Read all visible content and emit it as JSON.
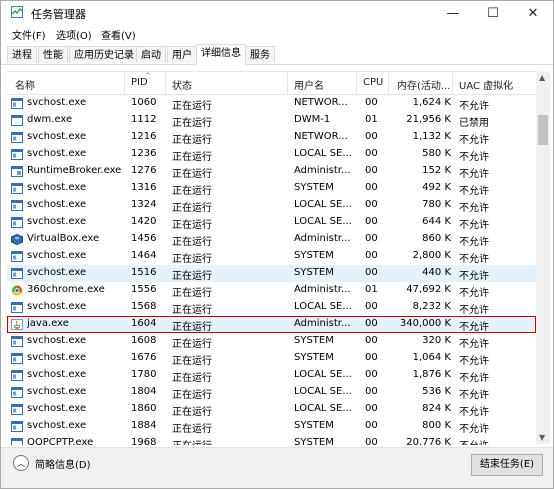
{
  "window": {
    "title": "任务管理器"
  },
  "menu": [
    "文件(F)",
    "选项(O)",
    "查看(V)"
  ],
  "tabs": [
    "进程",
    "性能",
    "应用历史记录",
    "启动",
    "用户",
    "详细信息",
    "服务"
  ],
  "active_tab": "详细信息",
  "columns": [
    "名称",
    "PID",
    "状态",
    "用户名",
    "CPU",
    "内存(活动...",
    "UAC 虚拟化"
  ],
  "rows": [
    {
      "icon": "svchost-icon",
      "name": "svchost.exe",
      "pid": "1060",
      "status": "正在运行",
      "user": "NETWOR...",
      "cpu": "00",
      "mem": "1,624 K",
      "uac": "不允许"
    },
    {
      "icon": "dwm-icon",
      "name": "dwm.exe",
      "pid": "1112",
      "status": "正在运行",
      "user": "DWM-1",
      "cpu": "01",
      "mem": "21,956 K",
      "uac": "已禁用"
    },
    {
      "icon": "svchost-icon",
      "name": "svchost.exe",
      "pid": "1216",
      "status": "正在运行",
      "user": "NETWOR...",
      "cpu": "00",
      "mem": "1,132 K",
      "uac": "不允许"
    },
    {
      "icon": "svchost-icon",
      "name": "svchost.exe",
      "pid": "1236",
      "status": "正在运行",
      "user": "LOCAL SE...",
      "cpu": "00",
      "mem": "580 K",
      "uac": "不允许"
    },
    {
      "icon": "runtimebroker-icon",
      "name": "RuntimeBroker.exe",
      "pid": "1276",
      "status": "正在运行",
      "user": "Administr...",
      "cpu": "00",
      "mem": "152 K",
      "uac": "不允许"
    },
    {
      "icon": "svchost-icon",
      "name": "svchost.exe",
      "pid": "1316",
      "status": "正在运行",
      "user": "SYSTEM",
      "cpu": "00",
      "mem": "492 K",
      "uac": "不允许"
    },
    {
      "icon": "svchost-icon",
      "name": "svchost.exe",
      "pid": "1324",
      "status": "正在运行",
      "user": "LOCAL SE...",
      "cpu": "00",
      "mem": "780 K",
      "uac": "不允许"
    },
    {
      "icon": "svchost-icon",
      "name": "svchost.exe",
      "pid": "1420",
      "status": "正在运行",
      "user": "LOCAL SE...",
      "cpu": "00",
      "mem": "644 K",
      "uac": "不允许"
    },
    {
      "icon": "virtualbox-icon",
      "name": "VirtualBox.exe",
      "pid": "1456",
      "status": "正在运行",
      "user": "Administr...",
      "cpu": "00",
      "mem": "860 K",
      "uac": "不允许"
    },
    {
      "icon": "svchost-icon",
      "name": "svchost.exe",
      "pid": "1464",
      "status": "正在运行",
      "user": "SYSTEM",
      "cpu": "00",
      "mem": "2,800 K",
      "uac": "不允许"
    },
    {
      "icon": "svchost-icon",
      "name": "svchost.exe",
      "pid": "1516",
      "status": "正在运行",
      "user": "SYSTEM",
      "cpu": "00",
      "mem": "440 K",
      "uac": "不允许"
    },
    {
      "icon": "360chrome-icon",
      "name": "360chrome.exe",
      "pid": "1556",
      "status": "正在运行",
      "user": "Administr...",
      "cpu": "01",
      "mem": "47,692 K",
      "uac": "不允许"
    },
    {
      "icon": "svchost-icon",
      "name": "svchost.exe",
      "pid": "1568",
      "status": "正在运行",
      "user": "LOCAL SE...",
      "cpu": "00",
      "mem": "8,232 K",
      "uac": "不允许"
    },
    {
      "icon": "java-icon",
      "name": "java.exe",
      "pid": "1604",
      "status": "正在运行",
      "user": "Administr...",
      "cpu": "00",
      "mem": "340,000 K",
      "uac": "不允许"
    },
    {
      "icon": "svchost-icon",
      "name": "svchost.exe",
      "pid": "1608",
      "status": "正在运行",
      "user": "SYSTEM",
      "cpu": "00",
      "mem": "320 K",
      "uac": "不允许"
    },
    {
      "icon": "svchost-icon",
      "name": "svchost.exe",
      "pid": "1676",
      "status": "正在运行",
      "user": "SYSTEM",
      "cpu": "00",
      "mem": "1,064 K",
      "uac": "不允许"
    },
    {
      "icon": "svchost-icon",
      "name": "svchost.exe",
      "pid": "1780",
      "status": "正在运行",
      "user": "LOCAL SE...",
      "cpu": "00",
      "mem": "1,876 K",
      "uac": "不允许"
    },
    {
      "icon": "svchost-icon",
      "name": "svchost.exe",
      "pid": "1804",
      "status": "正在运行",
      "user": "LOCAL SE...",
      "cpu": "00",
      "mem": "536 K",
      "uac": "不允许"
    },
    {
      "icon": "svchost-icon",
      "name": "svchost.exe",
      "pid": "1860",
      "status": "正在运行",
      "user": "LOCAL SE...",
      "cpu": "00",
      "mem": "824 K",
      "uac": "不允许"
    },
    {
      "icon": "svchost-icon",
      "name": "svchost.exe",
      "pid": "1884",
      "status": "正在运行",
      "user": "SYSTEM",
      "cpu": "00",
      "mem": "800 K",
      "uac": "不允许"
    },
    {
      "icon": "oqpcptp-icon",
      "name": "OQPCPTP.exe",
      "pid": "1968",
      "status": "正在运行",
      "user": "SYSTEM",
      "cpu": "00",
      "mem": "20,776 K",
      "uac": "不允许"
    }
  ],
  "selected_row_index": 10,
  "highlighted_row_index": 13,
  "footer": {
    "fewer_details": "简略信息(D)",
    "end_task": "结束任务(E)"
  },
  "colors": {
    "highlight_border": "#c00000",
    "selection_bg": "#e5f1fb"
  }
}
